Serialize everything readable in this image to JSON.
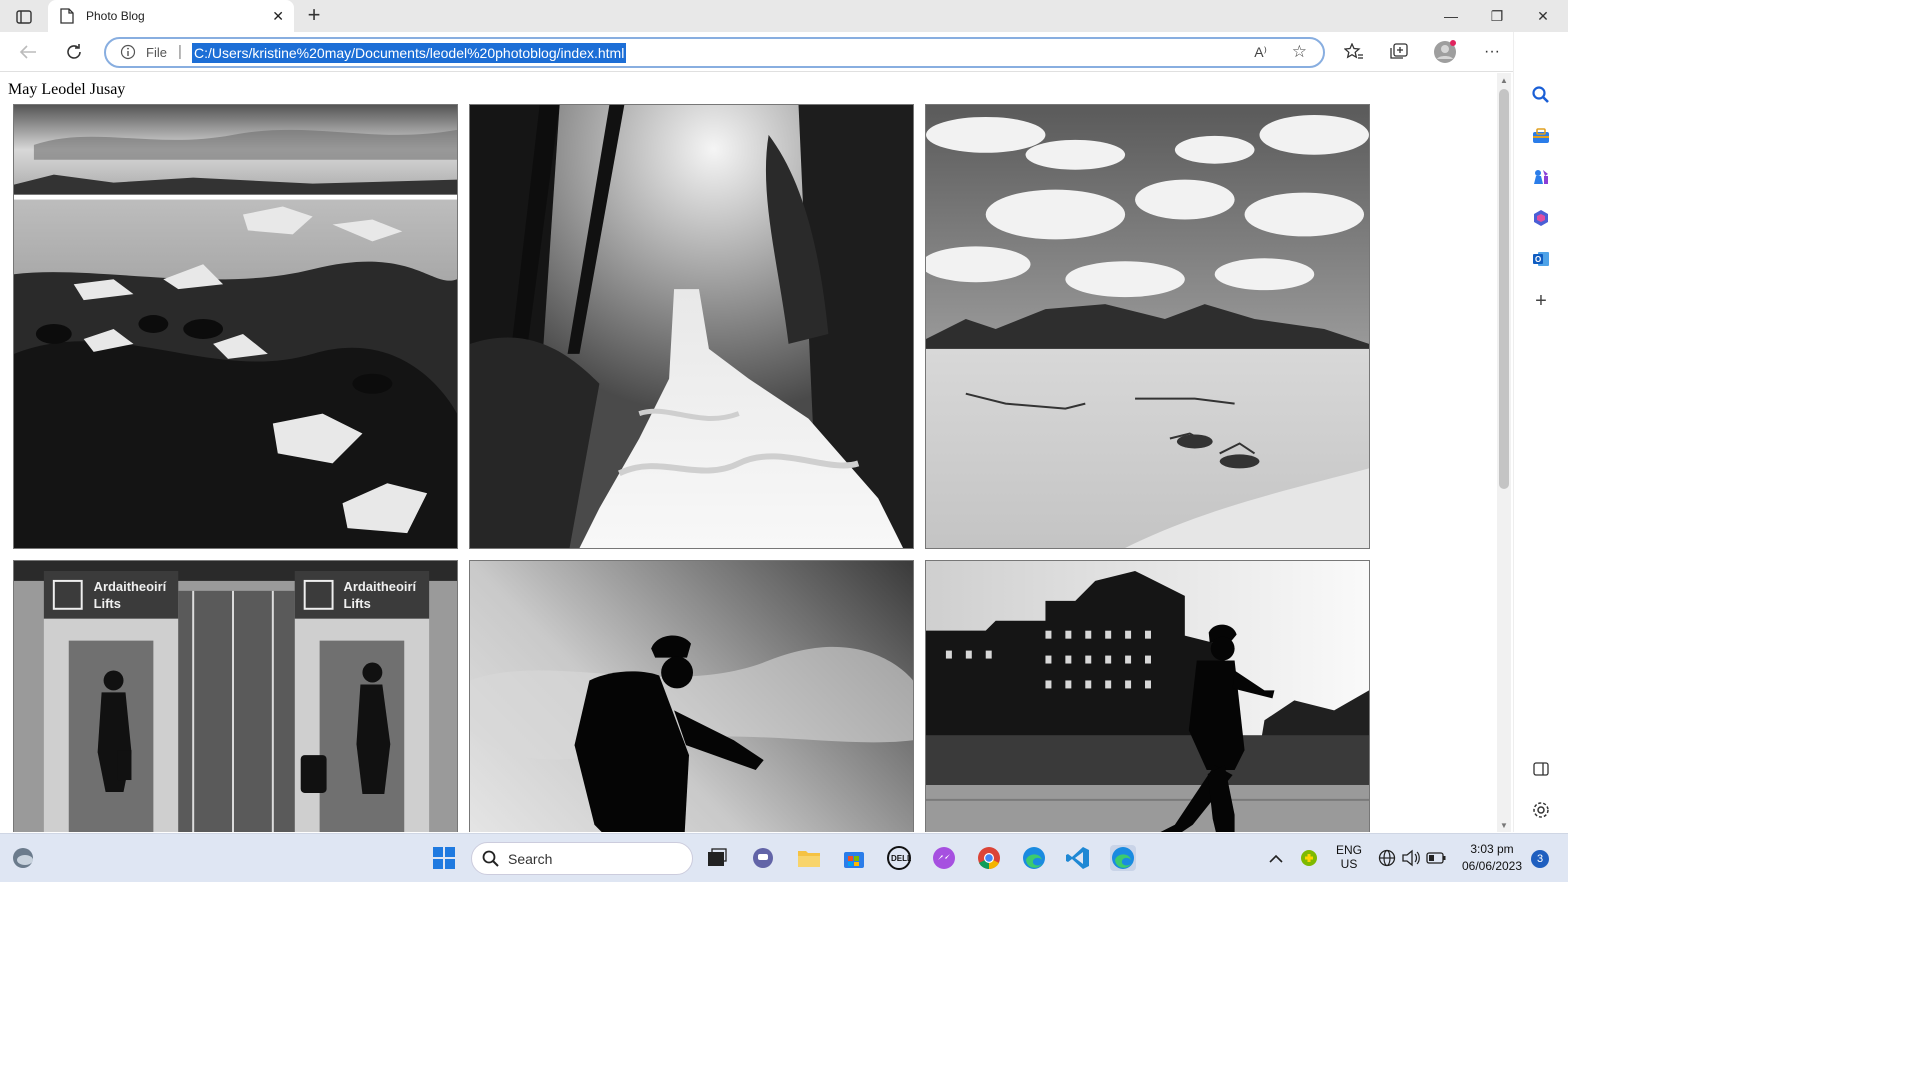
{
  "browser": {
    "tab_title": "Photo Blog",
    "new_tab_symbol": "+",
    "omnibox": {
      "scheme_label": "File",
      "url": "C:/Users/kristine%20may/Documents/leodel%20photoblog/index.html",
      "read_aloud_label": "A⁾"
    }
  },
  "page": {
    "author": "May Leodel Jusay",
    "photos": [
      {
        "name": "glacier-lagoon-ice"
      },
      {
        "name": "forest-waterfall"
      },
      {
        "name": "desert-dunes-clouds"
      },
      {
        "name": "airport-lifts",
        "signs": [
          "Ardaitheoirí",
          "Lifts",
          "Ardaitheoirí",
          "Lifts"
        ]
      },
      {
        "name": "cyclist-silhouette"
      },
      {
        "name": "city-walker-silhouette"
      }
    ]
  },
  "taskbar": {
    "search_label": "Search",
    "language": "ENG",
    "region": "US",
    "time": "3:03 pm",
    "date": "06/06/2023",
    "notification_count": "3"
  }
}
